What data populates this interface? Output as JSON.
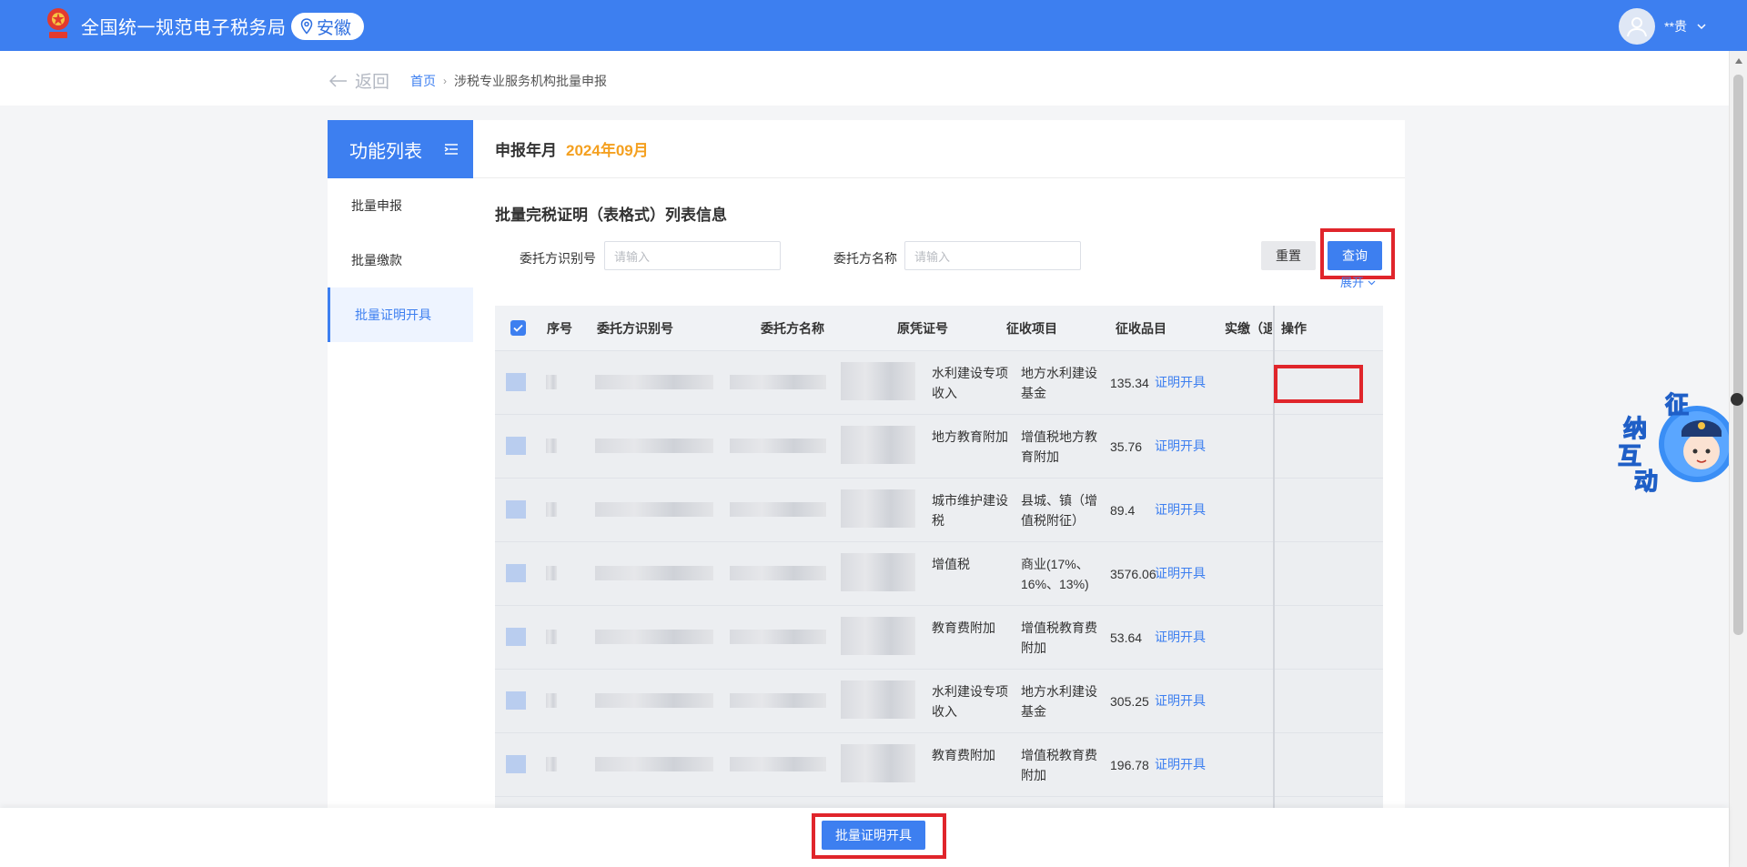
{
  "header": {
    "site_title": "全国统一规范电子税务局",
    "region": "安徽",
    "user": "**贵"
  },
  "nav": {
    "back_label": "返回",
    "breadcrumb_home": "首页",
    "breadcrumb_current": "涉税专业服务机构批量申报"
  },
  "sidebar": {
    "title": "功能列表",
    "items": [
      {
        "label": "批量申报"
      },
      {
        "label": "批量缴款"
      },
      {
        "label": "批量证明开具"
      }
    ]
  },
  "main": {
    "period_label": "申报年月",
    "period_value": "2024年09月",
    "list_title": "批量完税证明（表格式）列表信息",
    "filters": {
      "client_id_label": "委托方识别号",
      "client_id_placeholder": "请输入",
      "client_name_label": "委托方名称",
      "client_name_placeholder": "请输入"
    },
    "reset_label": "重置",
    "query_label": "查询",
    "expand_label": "展开",
    "table": {
      "headers": [
        "序号",
        "委托方识别号",
        "委托方名称",
        "原凭证号",
        "征收项目",
        "征收品目",
        "实缴（退",
        "操作"
      ],
      "action_label": "证明开具",
      "rows": [
        {
          "item": "水利建设专项收入",
          "subitem": "地方水利建设基金",
          "amount": "135.34"
        },
        {
          "item": "地方教育附加",
          "subitem": "增值税地方教育附加",
          "amount": "35.76"
        },
        {
          "item": "城市维护建设税",
          "subitem": "县城、镇（增值税附征）",
          "amount": "89.4"
        },
        {
          "item": "增值税",
          "subitem": "商业(17%、16%、13%)",
          "amount": "3576.06"
        },
        {
          "item": "教育费附加",
          "subitem": "增值税教育费附加",
          "amount": "53.64"
        },
        {
          "item": "水利建设专项收入",
          "subitem": "地方水利建设基金",
          "amount": "305.25"
        },
        {
          "item": "教育费附加",
          "subitem": "增值税教育费附加",
          "amount": "196.78"
        }
      ]
    }
  },
  "footer": {
    "batch_button_label": "批量证明开具"
  },
  "widget": {
    "chars": [
      "征",
      "纳",
      "互",
      "动"
    ]
  },
  "colors": {
    "primary": "#3d7ff0",
    "accent": "#f4a020",
    "highlight": "#e0252b"
  }
}
